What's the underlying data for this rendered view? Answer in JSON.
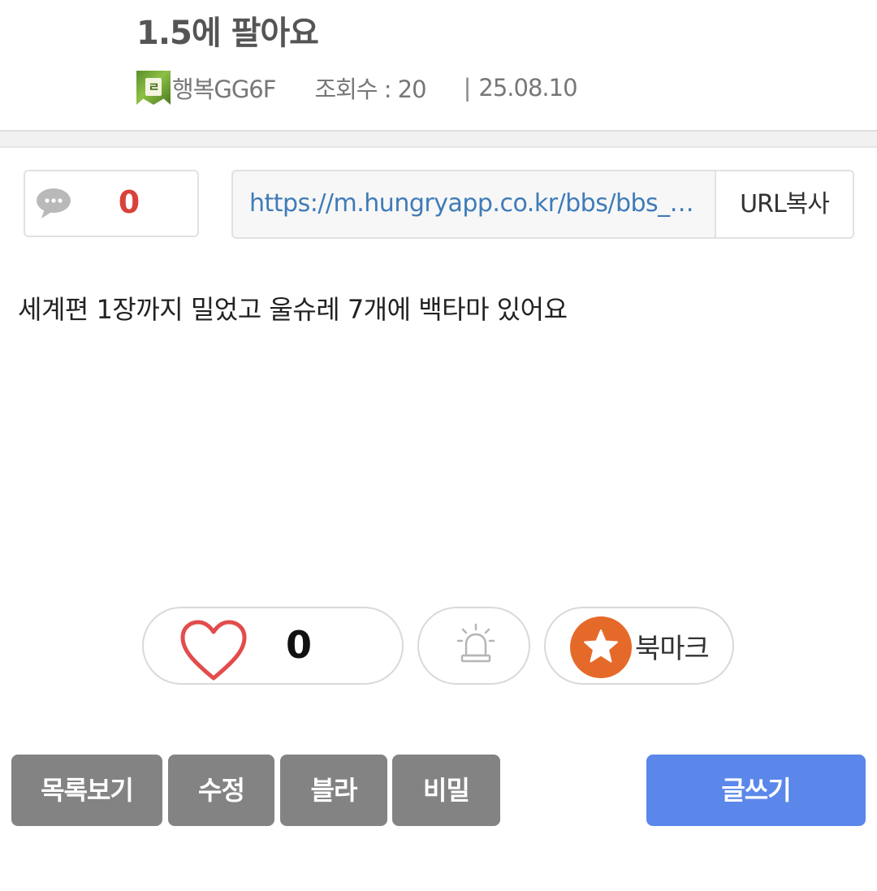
{
  "post": {
    "title": "1.5에 팔아요",
    "level_badge": "ㄹ",
    "author": "행복GG6F",
    "views": "조회수 : 20",
    "separator": "|",
    "date": "25.08.10",
    "body": "세계편 1장까지 밀었고 울슈레 7개에 백타마 있어요"
  },
  "comments": {
    "count": "0",
    "icon": "speech-bubble-icon"
  },
  "url": {
    "value": "https://m.hungryapp.co.kr/bbs/bbs_…",
    "copy_label": "URL복사"
  },
  "actions": {
    "like_count": "0",
    "like_icon": "heart-icon",
    "report_icon": "siren-icon",
    "bookmark_label": "북마크",
    "bookmark_icon": "star-icon"
  },
  "buttons": {
    "list": "목록보기",
    "edit": "수정",
    "blind": "블라",
    "secret": "비밀",
    "write": "글쓰기"
  },
  "colors": {
    "accent_blue": "#5b87ea",
    "comment_count_red": "#d8423a",
    "bookmark_orange": "#e56a2a",
    "url_blue": "#3f7bb8",
    "button_gray": "#838383"
  }
}
